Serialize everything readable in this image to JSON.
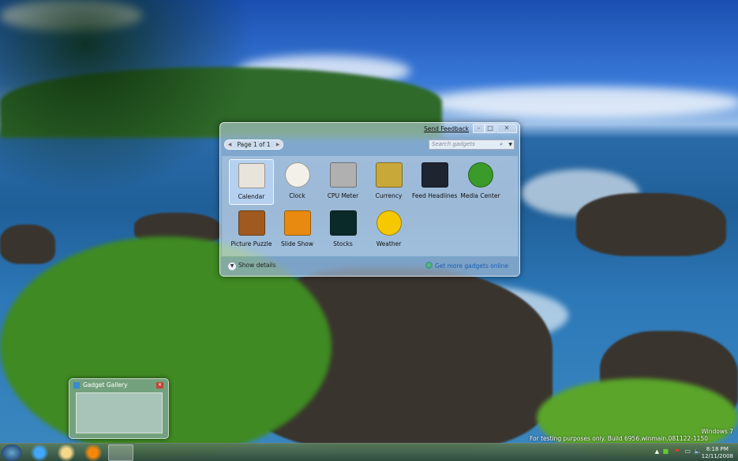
{
  "gallery": {
    "send_feedback": "Send Feedback",
    "page_label": "Page 1 of 1",
    "search_placeholder": "Search gadgets",
    "gadgets": [
      {
        "label": "Calendar",
        "icon": "calendar-icon",
        "color": "#e8e4dc",
        "selected": true
      },
      {
        "label": "Clock",
        "icon": "clock-icon",
        "color": "#f2f0e8"
      },
      {
        "label": "CPU Meter",
        "icon": "cpu-meter-icon",
        "color": "#b0b0b0"
      },
      {
        "label": "Currency",
        "icon": "currency-icon",
        "color": "#c8a838"
      },
      {
        "label": "Feed Headlines",
        "icon": "feed-headlines-icon",
        "color": "#1e2430"
      },
      {
        "label": "Media Center",
        "icon": "media-center-icon",
        "color": "#3a9a2a"
      },
      {
        "label": "Picture Puzzle",
        "icon": "picture-puzzle-icon",
        "color": "#a05a20"
      },
      {
        "label": "Slide Show",
        "icon": "slide-show-icon",
        "color": "#e88a10"
      },
      {
        "label": "Stocks",
        "icon": "stocks-icon",
        "color": "#0a2a2a"
      },
      {
        "label": "Weather",
        "icon": "weather-icon",
        "color": "#f5c800"
      }
    ],
    "show_details": "Show details",
    "get_more": "Get more gadgets online"
  },
  "thumbnail": {
    "title": "Gadget Gallery"
  },
  "watermark": {
    "line1": "Windows 7",
    "line2": "For testing purposes only. Build 6956.winmain.081122-1150"
  },
  "clock": {
    "time": "8:18 PM",
    "date": "12/11/2008"
  }
}
